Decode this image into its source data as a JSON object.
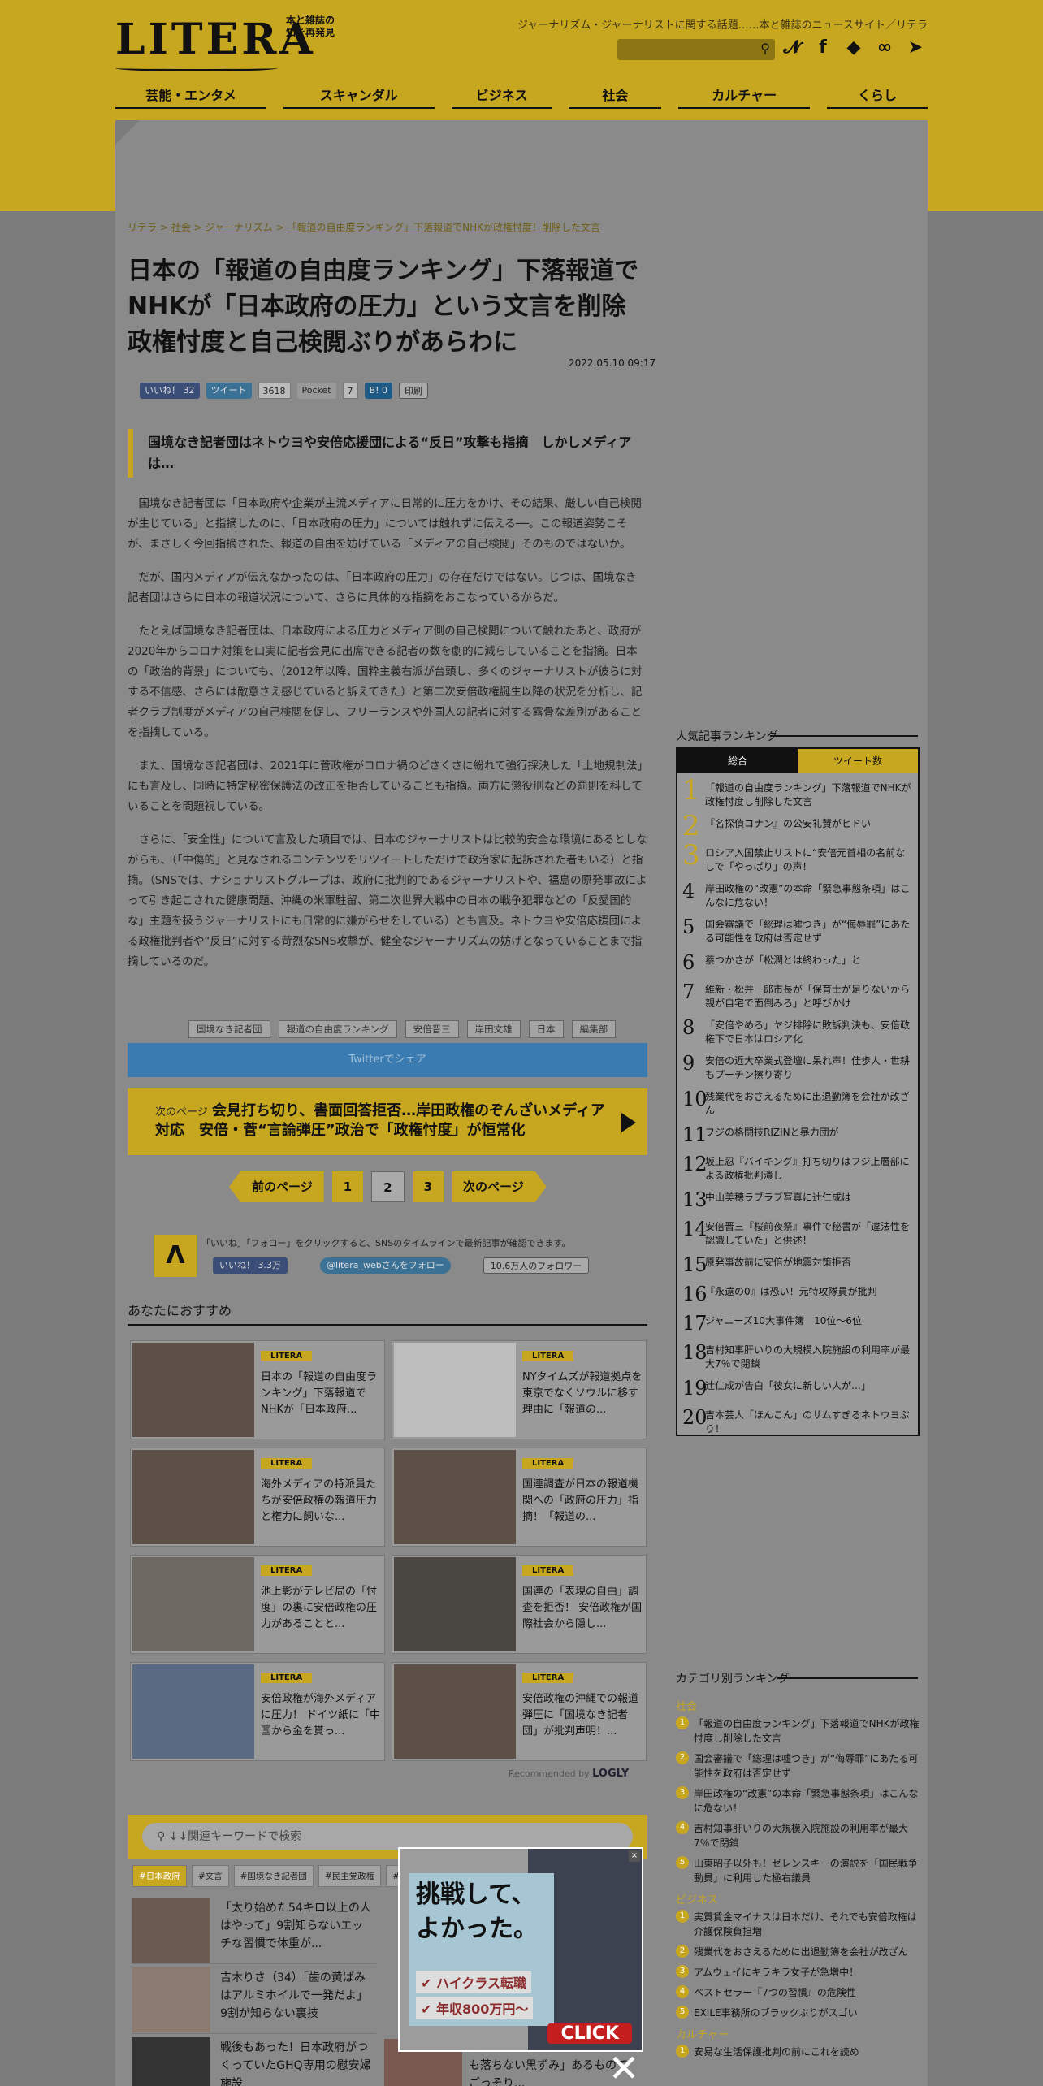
{
  "header": {
    "logo": "LITERA",
    "logo_sub": "本と雑誌の知を再発見",
    "tagline": "ジャーナリズム・ジャーナリストに関する話題……本と雑誌のニュースサイト／リテラ",
    "search_icon": "search-icon",
    "social": [
      "twitter-icon",
      "facebook-icon",
      "feedly-icon",
      "rss-icon",
      "telegram-icon"
    ]
  },
  "nav": [
    "芸能・エンタメ",
    "スキャンダル",
    "ビジネス",
    "社会",
    "カルチャー",
    "くらし"
  ],
  "breadcrumb": [
    "リテラ",
    "社会",
    "ジャーナリズム",
    "「報道の自由度ランキング」下落報道でNHKが政権忖度！削除した文言"
  ],
  "article": {
    "title": "日本の「報道の自由度ランキング」下落報道でNHKが「日本政府の圧力」という文言を削除 政権忖度と自己検閲ぶりがあらわに",
    "date": "2022.05.10 09:17",
    "share": {
      "fb": "いいね！ 32",
      "tw": "ツイート",
      "tw_count": "3618",
      "pocket": "Pocket",
      "pocket_count": "7",
      "hb": "B! 0",
      "print": "印刷"
    },
    "lead": "国境なき記者団はネトウヨや安倍応援団による“反日”攻撃も指摘　しかしメディアは…",
    "paragraphs": [
      "国境なき記者団は「日本政府や企業が主流メディアに日常的に圧力をかけ、その結果、厳しい自己検閲が生じている」と指摘したのに、「日本政府の圧力」については触れずに伝える──。この報道姿勢こそが、まさしく今回指摘された、報道の自由を妨げている「メディアの自己検閲」そのものではないか。",
      "だが、国内メディアが伝えなかったのは、「日本政府の圧力」の存在だけではない。じつは、国境なき記者団はさらに日本の報道状況について、さらに具体的な指摘をおこなっているからだ。",
      "たとえば国境なき記者団は、日本政府による圧力とメディア側の自己検閲について触れたあと、政府が2020年からコロナ対策を口実に記者会見に出席できる記者の数を劇的に減らしていることを指摘。日本の「政治的背景」についても、（2012年以降、国粋主義右派が台頭し、多くのジャーナリストが彼らに対する不信感、さらには敵意さえ感じていると訴えてきた）と第二次安倍政権誕生以降の状況を分析し、記者クラブ制度がメディアの自己検閲を促し、フリーランスや外国人の記者に対する露骨な差別があることを指摘している。",
      "また、国境なき記者団は、2021年に菅政権がコロナ禍のどさくさに紛れて強行採決した「土地規制法」にも言及し、同時に特定秘密保護法の改正を拒否していることも指摘。両方に懲役刑などの罰則を科していることを問題視している。",
      "さらに、「安全性」について言及した項目では、日本のジャーナリストは比較的安全な環境にあるとしながらも、（「中傷的」と見なされるコンテンツをリツイートしただけで政治家に起訴された者もいる）と指摘。（SNSでは、ナショナリストグループは、政府に批判的であるジャーナリストや、福島の原発事故によって引き起こされた健康問題、沖縄の米軍駐留、第二次世界大戦中の日本の戦争犯罪などの「反愛国的な」主題を扱うジャーナリストにも日常的に嫌がらせをしている）とも言及。ネトウヨや安倍応援団による政権批判者や“反日”に対する苛烈なSNS攻撃が、健全なジャーナリズムの妨げとなっていることまで指摘しているのだ。"
    ],
    "tags": [
      "国境なき記者団",
      "報道の自由度ランキング",
      "安倍晋三",
      "岸田文雄",
      "日本",
      "編集部"
    ],
    "twitter_share": "Twitterでシェア",
    "next_label": "次のページ",
    "next_title": "会見打ち切り、書面回答拒否…岸田政権のぞんざいメディア対応　安倍・菅“言論弾圧”政治で「政権忖度」が恒常化",
    "pager": {
      "prev": "前のページ",
      "pages": [
        "1",
        "2",
        "3"
      ],
      "next": "次のページ"
    }
  },
  "follow": {
    "text": "「いいね」「フォロー」をクリックすると、SNSのタイムラインで最新記事が確認できます。",
    "fb": "いいね！ 3.3万",
    "tw": "@litera_webさんをフォロー",
    "followers": "10.6万人のフォロワー"
  },
  "recommend": {
    "heading": "あなたにおすすめ",
    "badge": "LITERA",
    "items": [
      "日本の「報道の自由度ランキング」下落報道でNHKが「日本政府...",
      "NYタイムズが報道拠点を東京でなくソウルに移す理由に「報道の...",
      "海外メディアの特派員たちが安倍政権の報道圧力と権力に飼いな...",
      "国連調査が日本の報道機関への「政府の圧力」指摘！「報道の...",
      "池上彰がテレビ局の「忖度」の裏に安倍政権の圧力があることと...",
      "国連の「表現の自由」調査を拒否！ 安倍政権が国際社会から隠し...",
      "安倍政権が海外メディアに圧力！ ドイツ紙に「中国から金を貰っ...",
      "安倍政権の沖縄での報道弾圧に「国境なき記者団」が批判声明！..."
    ],
    "logly": "Recommended by",
    "logly_brand": "LOGLY"
  },
  "search": {
    "placeholder": "↓↓関連キーワードで検索",
    "tabs": [
      "#日本政府",
      "#文言",
      "#国境なき記者団",
      "#民主党政権",
      "#下落"
    ],
    "items": [
      "「太り始めた54キロ以上の人はやって」9割知らないエッチな習慣で体重が...",
      "吉木りさ（34）「歯の黄ばみはアルミホイルで一発だよ」9割が知らない裏技",
      "戦後もあった！日本政府がつくっていたGHQ専用の慰安婦施設"
    ],
    "right_item": "9割が知らない「普通に洗っても落ちない黒ずみ」あるものでごっそり..."
  },
  "ad": {
    "headline": "挑戦して、よかった。",
    "row1": "ハイクラス転職",
    "row2": "年収800万円〜",
    "click": "CLICK"
  },
  "ranking": {
    "heading": "人気記事ランキング",
    "tabs": [
      "総合",
      "ツイート数"
    ],
    "items": [
      "「報道の自由度ランキング」下落報道でNHKが政権忖度し削除した文言",
      "『名探偵コナン』の公安礼賛がヒドい",
      "ロシア入国禁止リストに“安倍元首相の名前なしで「やっぱり」の声！",
      "岸田政権の“改憲”の本命「緊急事態条項」はこんなに危ない！",
      "国会審議で「総理は嘘つき」が“侮辱罪”にあたる可能性を政府は否定せず",
      "蔡つかさが「松潤とは終わった」と",
      "維新・松井一郎市長が「保育士が足りないから親が自宅で面倒みろ」と呼びかけ",
      "「安倍やめろ」ヤジ排除に敗訴判決も、安倍政権下で日本はロシア化",
      "安倍の近大卒業式登壇に呆れ声！佳歩人・世耕もプーチン擦り寄り",
      "残業代をおさえるために出退勤簿を会社が改ざん",
      "フジの格闘技RIZINと暴力団が",
      "坂上忍『バイキング』打ち切りはフジ上層部による政権批判潰し",
      "中山美穂ラブラブ写真に辻仁成は",
      "安倍晋三『桜前夜祭』事件で秘書が「違法性を認識していた」と供述！",
      "原発事故前に安倍が地震対策拒否",
      "『永遠の0』は恐い！元特攻隊員が批判",
      "ジャニーズ10大事件簿　10位〜6位",
      "吉村知事肝いりの大規模入院施設の利用率が最大7％で閉鎖",
      "辻仁成が告白「彼女に新しい人が…」",
      "吉本芸人「ほんこん」のサムすぎるネトウヨぶり！"
    ]
  },
  "category_ranking": {
    "heading": "カテゴリ別ランキング",
    "sections": [
      {
        "name": "社会",
        "items": [
          "「報道の自由度ランキング」下落報道でNHKが政権忖度し削除した文言",
          "国会審議で「総理は嘘つき」が“侮辱罪”にあたる可能性を政府は否定せず",
          "岸田政権の“改憲”の本命「緊急事態条項」はこんなに危ない！",
          "吉村知事肝いりの大規模入院施設の利用率が最大7％で閉鎖",
          "山東昭子以外も！ゼレンスキーの演説を「国民戦争動員」に利用した極右議員"
        ]
      },
      {
        "name": "ビジネス",
        "items": [
          "実質賃金マイナスは日本だけ、それでも安倍政権は介護保険負担増",
          "残業代をおさえるために出退勤簿を会社が改ざん",
          "アムウェイにキラキラ女子が急増中！",
          "ベストセラー『7つの習慣』の危険性",
          "EXILE事務所のブラックぶりがスゴい"
        ]
      },
      {
        "name": "カルチャー",
        "items": [
          "安易な生活保護批判の前にこれを読め"
        ]
      }
    ]
  }
}
